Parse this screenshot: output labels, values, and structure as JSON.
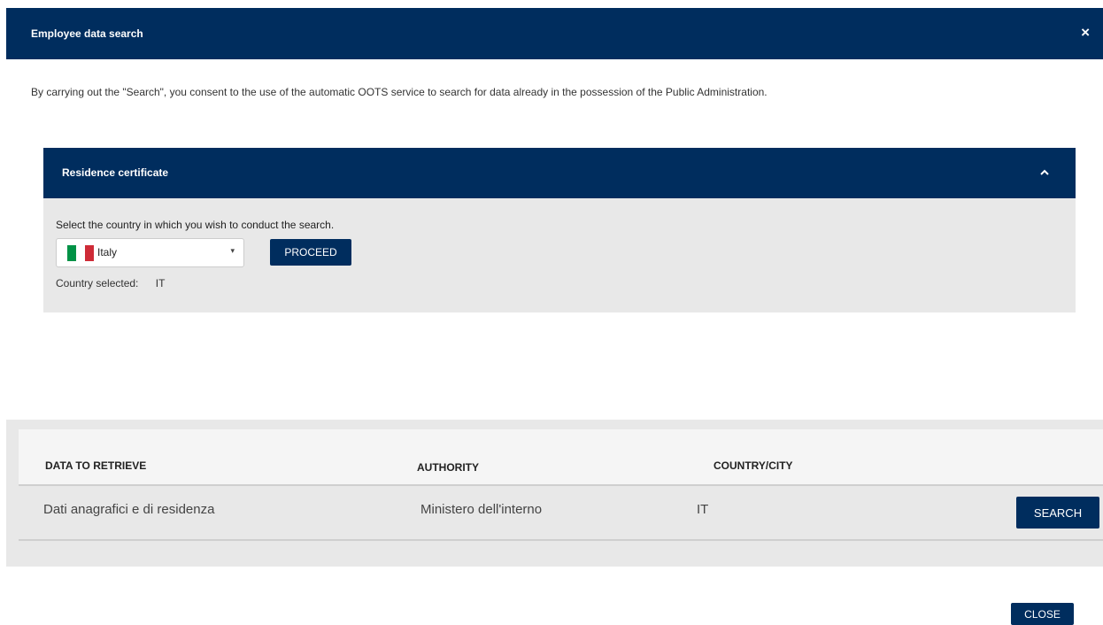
{
  "dialog": {
    "title": "Employee data search",
    "close_icon": "×",
    "consent_text": "By carrying out the \"Search\", you consent to the use of the automatic OOTS service to search for data already in the possession of the Public Administration."
  },
  "panel": {
    "title": "Residence certificate",
    "toggle_icon": "chevron-up-icon",
    "prompt": "Select the country in which you wish to conduct the search.",
    "country_select": {
      "value": "Italy",
      "flag_colors": [
        "#009246",
        "#ffffff",
        "#ce2b37"
      ],
      "caret": "▾"
    },
    "proceed_label": "PROCEED",
    "country_selected_label": "Country selected:",
    "country_selected_value": "IT"
  },
  "table": {
    "headers": [
      "DATA TO RETRIEVE",
      "AUTHORITY",
      "COUNTRY/CITY"
    ],
    "rows": [
      {
        "data": "Dati anagrafici e di residenza",
        "authority": "Ministero dell'interno",
        "country": "IT",
        "action": "SEARCH"
      }
    ]
  },
  "footer": {
    "close_label": "CLOSE"
  },
  "colors": {
    "primary": "#002d5e",
    "panel_bg": "#e8e8e8"
  }
}
